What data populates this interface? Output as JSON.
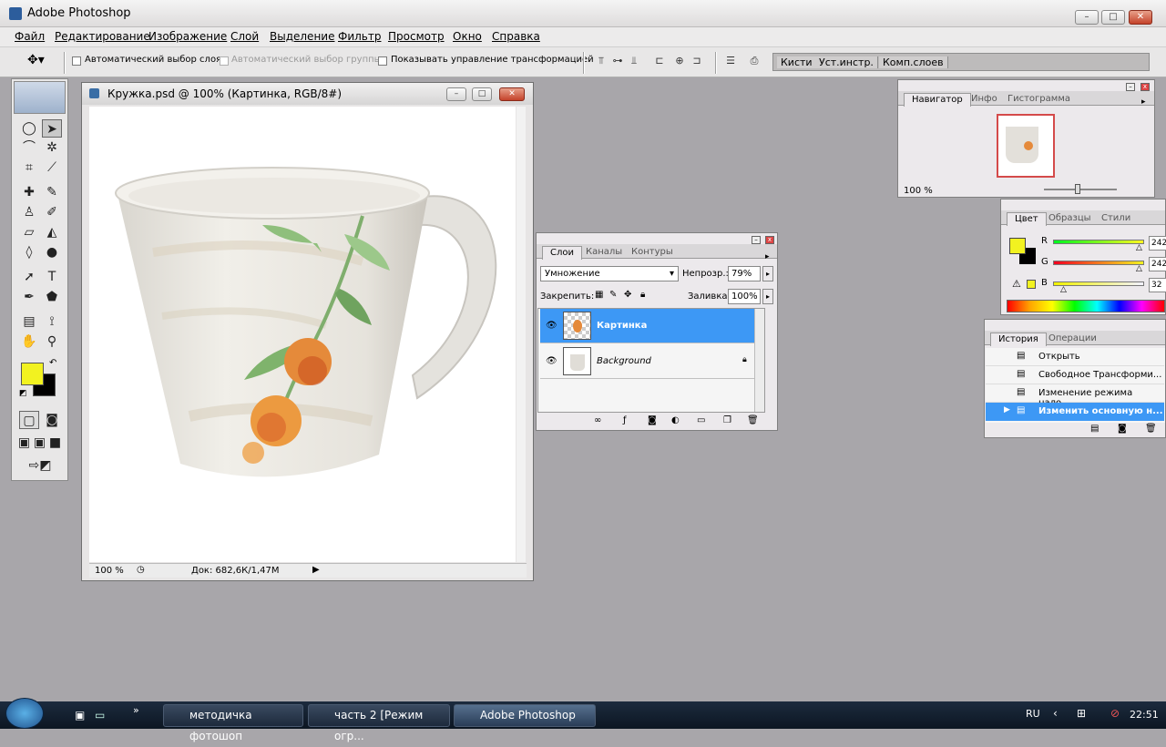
{
  "app": {
    "title": "Adobe Photoshop"
  },
  "menu": [
    "Файл",
    "Редактирование",
    "Изображение",
    "Слой",
    "Выделение",
    "Фильтр",
    "Просмотр",
    "Окно",
    "Справка"
  ],
  "options": {
    "auto_select_layer": "Автоматический выбор слоя",
    "auto_select_group": "Автоматический выбор группы",
    "show_transform": "Показывать управление трансформацией",
    "wells": [
      "Кисти",
      "Уст.инстр.",
      "Комп.слоев"
    ]
  },
  "document": {
    "title": "Кружка.psd @ 100% (Картинка, RGB/8#)",
    "zoom": "100 %",
    "doc_size": "Док: 682,6К/1,47М"
  },
  "navigator": {
    "tabs": [
      "Навигатор",
      "Инфо",
      "Гистограмма"
    ],
    "zoom": "100 %"
  },
  "color_panel": {
    "tabs": [
      "Цвет",
      "Образцы",
      "Стили"
    ],
    "channels": [
      {
        "label": "R",
        "value": "242",
        "fraction": 0.95
      },
      {
        "label": "G",
        "value": "242",
        "fraction": 0.95
      },
      {
        "label": "B",
        "value": "32",
        "fraction": 0.12
      }
    ],
    "foreground": "#f2f220",
    "background": "#000000"
  },
  "layers": {
    "tabs": [
      "Слои",
      "Каналы",
      "Контуры"
    ],
    "blend_mode": "Умножение",
    "opacity_label": "Непрозр.:",
    "opacity": "79%",
    "lock_label": "Закрепить:",
    "fill_label": "Заливка:",
    "fill": "100%",
    "items": [
      {
        "name": "Картинка",
        "selected": true
      },
      {
        "name": "Background",
        "selected": false
      }
    ]
  },
  "history": {
    "tabs": [
      "История",
      "Операции"
    ],
    "items": [
      "Открыть",
      "Свободное Трансформи...",
      "Изменение режима нало...",
      "Изменить основную н..."
    ]
  },
  "taskbar": {
    "tasks": [
      "методичка фотошоп",
      "часть 2 [Режим огр...",
      "Adobe Photoshop"
    ],
    "lang": "RU",
    "time": "22:51"
  }
}
